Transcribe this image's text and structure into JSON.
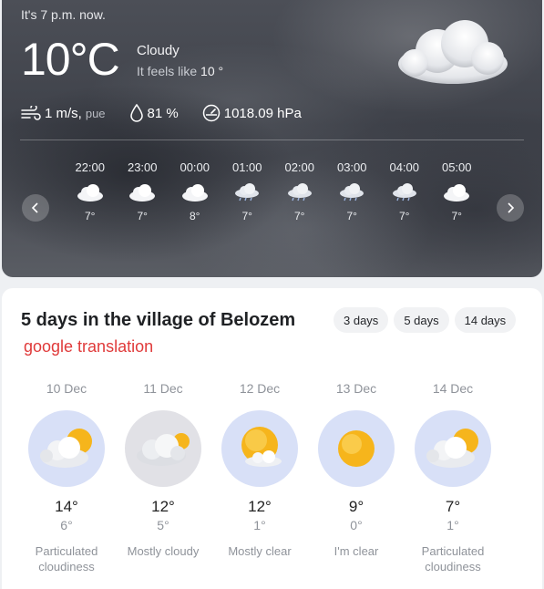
{
  "current": {
    "time_text": "It's 7 p.m. now.",
    "temperature": "10°C",
    "condition": "Cloudy",
    "feels_like_prefix": "It feels like",
    "feels_like_value": "10 °",
    "wind_speed": "1 m/s,",
    "wind_direction": "pue",
    "humidity": "81 %",
    "pressure": "1018.09 hPa"
  },
  "hourly": [
    {
      "time": "22:00",
      "temp": "7°",
      "icon": "cloud-icon"
    },
    {
      "time": "23:00",
      "temp": "7°",
      "icon": "cloud-icon"
    },
    {
      "time": "00:00",
      "temp": "8°",
      "icon": "cloud-icon"
    },
    {
      "time": "01:00",
      "temp": "7°",
      "icon": "rain-cloud-icon"
    },
    {
      "time": "02:00",
      "temp": "7°",
      "icon": "rain-cloud-icon"
    },
    {
      "time": "03:00",
      "temp": "7°",
      "icon": "rain-cloud-icon"
    },
    {
      "time": "04:00",
      "temp": "7°",
      "icon": "rain-cloud-icon"
    },
    {
      "time": "05:00",
      "temp": "7°",
      "icon": "cloud-icon"
    }
  ],
  "forecast": {
    "title": "5 days in the village of Belozem",
    "translation_note": "google translation",
    "range_buttons": [
      "3 days",
      "5 days",
      "14 days"
    ],
    "days": [
      {
        "date": "10 Dec",
        "high": "14°",
        "low": "6°",
        "description": "Particulated cloudiness",
        "icon": "partly-cloudy-icon"
      },
      {
        "date": "11 Dec",
        "high": "12°",
        "low": "5°",
        "description": "Mostly cloudy",
        "icon": "mostly-cloudy-icon"
      },
      {
        "date": "12 Dec",
        "high": "12°",
        "low": "1°",
        "description": "Mostly clear",
        "icon": "mostly-clear-icon"
      },
      {
        "date": "13 Dec",
        "high": "9°",
        "low": "0°",
        "description": "I'm clear",
        "icon": "sun-icon"
      },
      {
        "date": "14 Dec",
        "high": "7°",
        "low": "1°",
        "description": "Particulated cloudiness",
        "icon": "partly-cloudy-icon"
      }
    ]
  },
  "colors": {
    "accent_red": "#e03a3a",
    "day_circle": "#d8e0f7",
    "sun": "#f6b51c"
  }
}
